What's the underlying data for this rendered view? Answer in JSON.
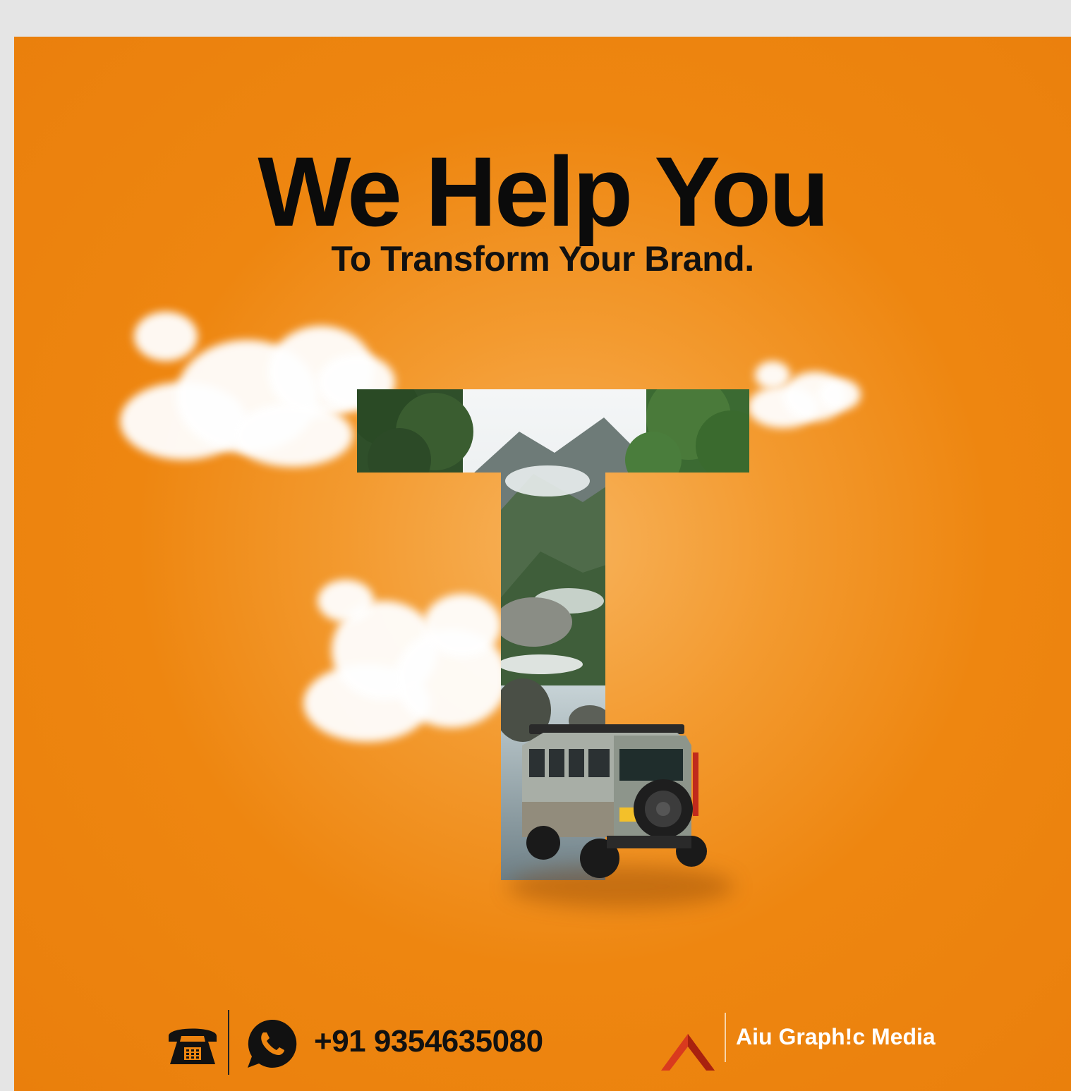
{
  "headline": "We Help You",
  "subheadline": "To Transform Your Brand.",
  "letter_graphic": {
    "icon": "landscape-letter-t",
    "scene": [
      "mountains",
      "trees",
      "river",
      "clouds",
      "off-road-vehicle"
    ]
  },
  "contact": {
    "phone_icon": "telephone-icon",
    "whatsapp_icon": "whatsapp-icon",
    "phone_number": "+91 9354635080"
  },
  "brand": {
    "logo_icon": "chevron-logo-icon",
    "name": "Aiu Graph!c Media"
  },
  "colors": {
    "background": "#ee8610",
    "text": "#0b0b0b",
    "brand_text": "#ffffff",
    "logo_red": "#d93a1e"
  }
}
